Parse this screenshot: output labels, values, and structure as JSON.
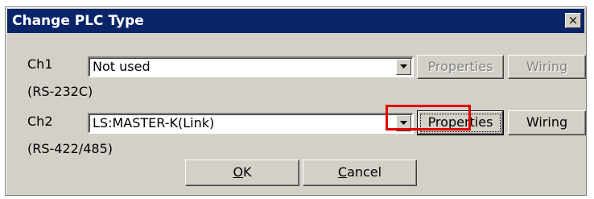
{
  "dialog": {
    "title": "Change PLC Type",
    "close_glyph": "×"
  },
  "ch1": {
    "label": "Ch1",
    "value": "Not used",
    "interface": "(RS-232C)",
    "properties_label": "Properties",
    "wiring_label": "Wiring",
    "enabled": false
  },
  "ch2": {
    "label": "Ch2",
    "value": "LS:MASTER-K(Link)",
    "interface": "(RS-422/485)",
    "properties_label": "Properties",
    "wiring_label": "Wiring",
    "enabled": true
  },
  "footer": {
    "ok_accel": "O",
    "ok_rest": "K",
    "cancel_accel": "C",
    "cancel_rest": "ancel"
  },
  "icons": {
    "dropdown": "triangle-down",
    "close": "x-mark"
  },
  "colors": {
    "title_bar": "#0a246a",
    "dialog_face": "#d4d0c8",
    "highlight": "#e00000"
  }
}
